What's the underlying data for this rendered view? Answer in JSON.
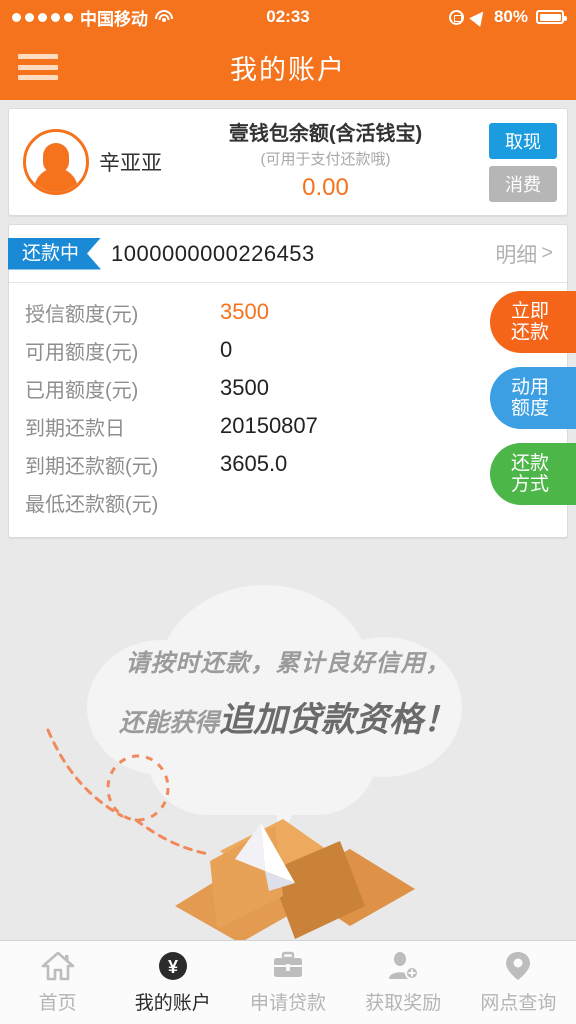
{
  "status_bar": {
    "carrier": "中国移动",
    "signal_dots": 5,
    "wifi_icon": "wifi-icon",
    "time": "02:33",
    "rotation_lock_icon": "rotation-lock-icon",
    "location_icon": "location-arrow-icon",
    "battery_percent": "80%",
    "battery_icon": "battery-icon"
  },
  "header": {
    "menu_icon": "hamburger-menu-icon",
    "title": "我的账户",
    "background_color": "#f4731c"
  },
  "account_card": {
    "avatar_icon": "user-avatar-icon",
    "user_name": "辛亚亚",
    "balance_title": "壹钱包余额(含活钱宝)",
    "balance_subtitle": "(可用于支付还款哦)",
    "balance_amount": "0.00",
    "balance_color": "#f4731c",
    "withdraw_button": "取现",
    "withdraw_color": "#1b9be0",
    "spend_button": "消费",
    "spend_color": "#b6b6b6"
  },
  "loan_card": {
    "status_badge": "还款中",
    "status_badge_color": "#1b8ad6",
    "account_number": "1000000000226453",
    "detail_link": "明细",
    "detail_chevron": "chevron-right-icon",
    "rows": [
      {
        "label": "授信额度(元)",
        "value": "3500",
        "highlight": true
      },
      {
        "label": "可用额度(元)",
        "value": "0",
        "highlight": false
      },
      {
        "label": "已用额度(元)",
        "value": "3500",
        "highlight": false
      },
      {
        "label": "到期还款日",
        "value": "20150807",
        "highlight": false
      },
      {
        "label": "到期还款额(元)",
        "value": "3605.0",
        "highlight": false
      },
      {
        "label": "最低还款额(元)",
        "value": "",
        "highlight": false
      }
    ],
    "side_buttons": [
      {
        "line1": "立即",
        "line2": "还款",
        "color": "#f4651a"
      },
      {
        "line1": "动用",
        "line2": "额度",
        "color": "#3c9fe3"
      },
      {
        "line1": "还款",
        "line2": "方式",
        "color": "#4cb648"
      }
    ]
  },
  "promo": {
    "line1": "请按时还款，累计良好信用，",
    "line2_prefix": "还能获得",
    "line2_strong": "追加贷款资格！",
    "cloud_icon": "speech-cloud-icon",
    "box_icon": "open-box-icon",
    "paper_plane_icon": "paper-plane-icon",
    "dashed_trail_icon": "dashed-trail-icon"
  },
  "tabbar": {
    "items": [
      {
        "label": "首页",
        "icon": "home-icon",
        "active": false
      },
      {
        "label": "我的账户",
        "icon": "yuan-circle-icon",
        "active": true
      },
      {
        "label": "申请贷款",
        "icon": "briefcase-icon",
        "active": false
      },
      {
        "label": "获取奖励",
        "icon": "person-add-icon",
        "active": false
      },
      {
        "label": "网点查询",
        "icon": "location-pin-icon",
        "active": false
      }
    ]
  }
}
